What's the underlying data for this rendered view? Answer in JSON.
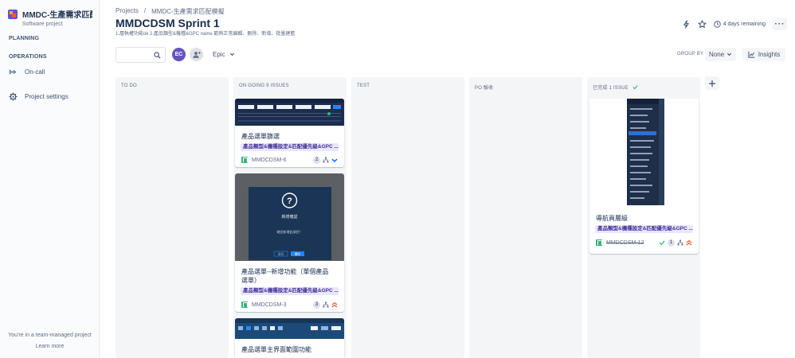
{
  "sidebar": {
    "project_name": "MMDC-生產需求匹配模...",
    "project_type": "Software project",
    "planning": "PLANNING",
    "operations": "OPERATIONS",
    "on_call": "On-call",
    "project_settings": "Project settings",
    "team_note": "You're in a team-managed project",
    "learn_more": "Learn more"
  },
  "header": {
    "breadcrumb_root": "Projects",
    "breadcrumb_sep": "/",
    "breadcrumb_project": "MMDC-生產需求匹配模擬",
    "title": "MMDCDSM Sprint 1",
    "goal": "1.層執權功能ok 2.產品類型&機種&GPC name 範夠正常編輯、刪除、新增、批量建籃",
    "remaining": "4 days remaining",
    "more": "···"
  },
  "toolbar": {
    "avatar_initials": "EC",
    "epic_label": "Epic",
    "group_by_label": "GROUP BY",
    "group_by_value": "None",
    "insights_label": "Insights"
  },
  "columns": [
    {
      "title": "TO DO"
    },
    {
      "title": "ON GOING 9 ISSUES"
    },
    {
      "title": "TEST"
    },
    {
      "title": "PO 驗收"
    },
    {
      "title": "已完成 1 ISSUE"
    }
  ],
  "cards": [
    {
      "title": "產品選單篩選",
      "epic": "產品類型&機種設定&匹配優先級&GPC ...",
      "key": "MMDCDSM-6",
      "points": "2"
    },
    {
      "title_line1": "產品選單--新增功能（單個產品",
      "title_line2": "選單）",
      "epic": "產品類型&機種設定&匹配優先級&GPC ...",
      "key": "MMDCDSM-3",
      "points": "3",
      "modal_title": "新增確認",
      "modal_text": "確定新增此項目？",
      "modal_cancel": "取消",
      "modal_ok": "確定"
    },
    {
      "title": "產品選單主界面範圍功能"
    },
    {
      "title": "導航頁層級",
      "epic": "產品類型&機種設定&匹配優先級&GPC ...",
      "key": "MMDCDSM-12",
      "points": "1"
    }
  ],
  "colors": {
    "accent": "#0052cc",
    "epic_bg": "#eae6ff",
    "epic_text": "#403294",
    "story": "#36b37e",
    "priority_high": "#ff5630",
    "priority_low": "#0065ff"
  }
}
